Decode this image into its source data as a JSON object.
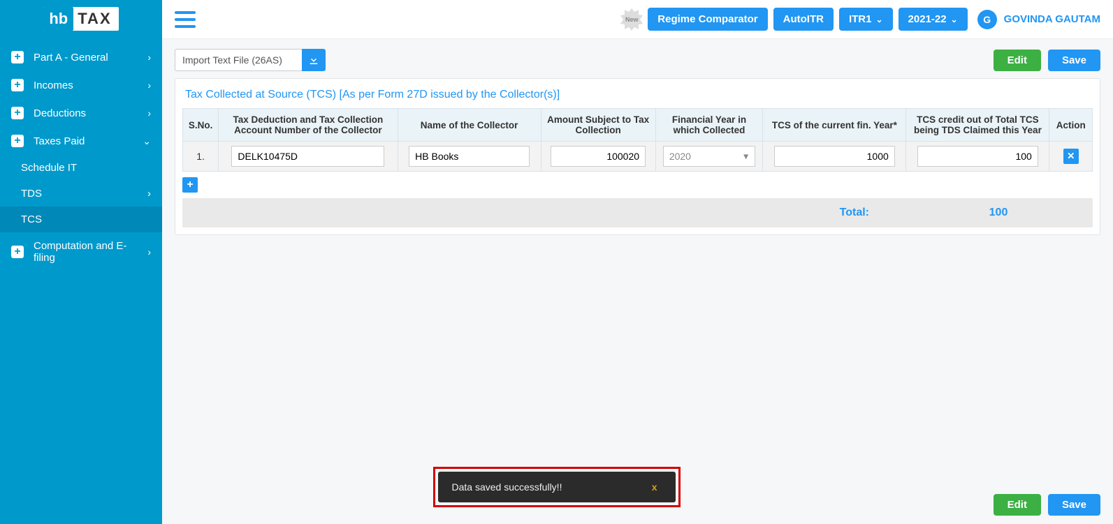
{
  "logo": {
    "hb": "hb",
    "tax": "TAX"
  },
  "sidebar": {
    "items": [
      {
        "label": "Part A - General"
      },
      {
        "label": "Incomes"
      },
      {
        "label": "Deductions"
      },
      {
        "label": "Taxes Paid"
      },
      {
        "label": "Computation and E-filing"
      }
    ],
    "sub": {
      "scheduleIT": "Schedule IT",
      "tds": "TDS",
      "tcs": "TCS"
    }
  },
  "topbar": {
    "newBadge": "New",
    "regime": "Regime Comparator",
    "autoitr": "AutoITR",
    "itr": "ITR1",
    "year": "2021-22",
    "avatar": "G",
    "user": "GOVINDA GAUTAM"
  },
  "toolbar": {
    "import": "Import Text File (26AS)",
    "edit": "Edit",
    "save": "Save"
  },
  "panel": {
    "title": "Tax Collected at Source (TCS) [As per Form 27D issued by the Collector(s)]",
    "headers": {
      "sno": "S.No.",
      "tan": "Tax Deduction and Tax Collection Account Number of the Collector",
      "name": "Name of the Collector",
      "amount": "Amount Subject to Tax Collection",
      "fy": "Financial Year in which Collected",
      "tcscurr": "TCS of the current fin. Year*",
      "credit": "TCS credit out of Total TCS being TDS Claimed this Year",
      "action": "Action"
    },
    "rows": [
      {
        "sno": "1.",
        "tan": "DELK10475D",
        "name": "HB Books",
        "amount": "100020",
        "fy": "2020",
        "tcscurr": "1000",
        "credit": "100"
      }
    ],
    "total_label": "Total:",
    "total_value": "100"
  },
  "toast": {
    "msg": "Data saved successfully!!",
    "close": "x"
  }
}
